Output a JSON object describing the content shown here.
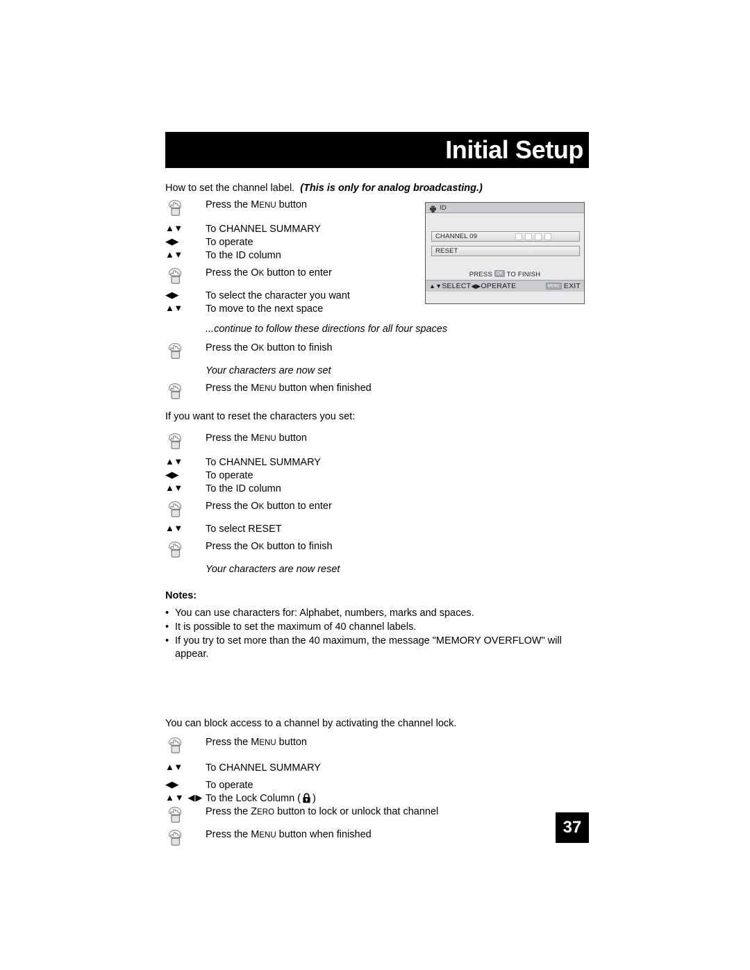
{
  "header": {
    "title": "Initial Setup"
  },
  "page_number": "37",
  "section_label": {
    "intro_plain": "How to set the channel label.",
    "intro_emphasis": "(This is only for analog broadcasting.)"
  },
  "steps_set_label": [
    {
      "icon": "hand-press-icon",
      "text_pre": "Press the ",
      "btn_big": "M",
      "btn_small": "ENU",
      "text_post": " button",
      "italic": false
    },
    {
      "icon": "updown-arrows-icon",
      "text_pre": "To CHANNEL SUMMARY",
      "btn_big": "",
      "btn_small": "",
      "text_post": "",
      "italic": false
    },
    {
      "icon": "leftright-arrows-icon",
      "text_pre": "To operate",
      "btn_big": "",
      "btn_small": "",
      "text_post": "",
      "italic": false
    },
    {
      "icon": "updown-arrows-icon",
      "text_pre": "To the ID column",
      "btn_big": "",
      "btn_small": "",
      "text_post": "",
      "italic": false
    },
    {
      "icon": "hand-press-icon",
      "text_pre": "Press the ",
      "btn_big": "O",
      "btn_small": "K",
      "text_post": " button to enter",
      "italic": false
    },
    {
      "icon": "leftright-arrows-icon",
      "text_pre": "To select the character you want",
      "btn_big": "",
      "btn_small": "",
      "text_post": "",
      "italic": false
    },
    {
      "icon": "updown-arrows-icon",
      "text_pre": "To move to the next space",
      "btn_big": "",
      "btn_small": "",
      "text_post": "",
      "italic": false
    }
  ],
  "continue_note": "...continue to follow these directions for all four spaces",
  "steps_finish": [
    {
      "icon": "hand-press-icon",
      "text_pre": "Press the ",
      "btn_big": "O",
      "btn_small": "K",
      "text_post": " button to finish",
      "italic": false
    },
    {
      "icon": "none",
      "text_pre": "Your characters are now set",
      "btn_big": "",
      "btn_small": "",
      "text_post": "",
      "italic": true
    },
    {
      "icon": "hand-press-icon",
      "text_pre": "Press the ",
      "btn_big": "M",
      "btn_small": "ENU",
      "text_post": " button when finished",
      "italic": false
    }
  ],
  "reset_intro": "If you want to reset the characters you set:",
  "steps_reset": [
    {
      "icon": "hand-press-icon",
      "text_pre": "Press the ",
      "btn_big": "M",
      "btn_small": "ENU",
      "text_post": " button",
      "italic": false
    },
    {
      "icon": "updown-arrows-icon",
      "text_pre": "To CHANNEL SUMMARY",
      "btn_big": "",
      "btn_small": "",
      "text_post": "",
      "italic": false
    },
    {
      "icon": "leftright-arrows-icon",
      "text_pre": "To operate",
      "btn_big": "",
      "btn_small": "",
      "text_post": "",
      "italic": false
    },
    {
      "icon": "updown-arrows-icon",
      "text_pre": "To the ID column",
      "btn_big": "",
      "btn_small": "",
      "text_post": "",
      "italic": false
    },
    {
      "icon": "hand-press-icon",
      "text_pre": "Press the ",
      "btn_big": "O",
      "btn_small": "K",
      "text_post": " button to enter",
      "italic": false
    },
    {
      "icon": "updown-arrows-icon",
      "text_pre": "To select RESET",
      "btn_big": "",
      "btn_small": "",
      "text_post": "",
      "italic": false
    },
    {
      "icon": "hand-press-icon",
      "text_pre": "Press the ",
      "btn_big": "O",
      "btn_small": "K",
      "text_post": " button to finish",
      "italic": false
    },
    {
      "icon": "none",
      "text_pre": "Your characters are now reset",
      "btn_big": "",
      "btn_small": "",
      "text_post": "",
      "italic": true
    }
  ],
  "notes": {
    "title": "Notes:",
    "bullet": "•",
    "items": [
      "You can use characters for: Alphabet, numbers, marks and spaces.",
      "It is possible to set the maximum of 40 channel labels.",
      "If you try to set more than the 40 maximum, the message \"MEMORY OVERFLOW\" will appear."
    ]
  },
  "lock_section": {
    "intro": "You can block access to a channel by activating the channel lock.",
    "steps": [
      {
        "icon": "hand-press-icon",
        "text_pre": "Press the ",
        "btn_big": "M",
        "btn_small": "ENU",
        "text_post": " button",
        "italic": false
      },
      {
        "icon": "updown-arrows-icon",
        "text_pre": "To CHANNEL SUMMARY",
        "btn_big": "",
        "btn_small": "",
        "text_post": "",
        "italic": false
      },
      {
        "icon": "leftright-arrows-icon",
        "text_pre": "To operate",
        "btn_big": "",
        "btn_small": "",
        "text_post": "",
        "italic": false
      }
    ],
    "lock_column_pre": "To the Lock Column (",
    "lock_column_post": ")",
    "zero_step": {
      "text_pre": "Press the ",
      "btn_big": "Z",
      "btn_small": "ERO",
      "text_post": " button to lock or unlock that channel"
    },
    "menu_step": {
      "text_pre": "Press the ",
      "btn_big": "M",
      "btn_small": "ENU",
      "text_post": " button when finished"
    }
  },
  "osd": {
    "title": "ID",
    "title_icon": "label-printer-icon",
    "rows": [
      {
        "label": "CHANNEL 09",
        "has_charboxes": true,
        "charbox_count": 4
      },
      {
        "label": "RESET",
        "has_charboxes": false,
        "charbox_count": 0
      }
    ],
    "finish_pre": "PRESS ",
    "finish_chip": "OK",
    "finish_post": " TO FINISH",
    "status_select": "SELECT",
    "status_operate": "OPERATE",
    "status_menu_chip": "MENU",
    "status_exit": "EXIT",
    "colors": {
      "panel_bg": "#e9eaec",
      "titlebar_bg": "#c9cbce",
      "border": "#58595b"
    }
  }
}
